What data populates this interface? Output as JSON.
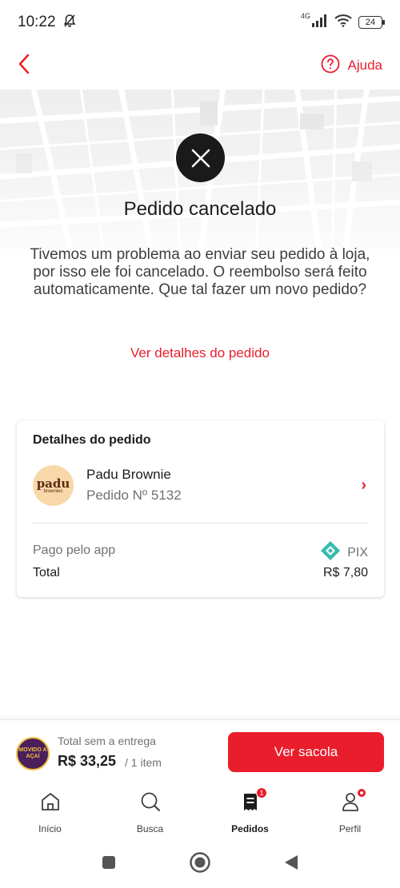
{
  "status_bar": {
    "time": "10:22",
    "network": "4G",
    "battery": "24"
  },
  "top_bar": {
    "help_label": "Ajuda"
  },
  "hero": {
    "title": "Pedido cancelado",
    "message": "Tivemos um problema ao enviar seu pedido à loja, por isso ele foi cancelado. O reembolso será feito automaticamente. Que tal fazer um novo pedido?",
    "details_link": "Ver detalhes do pedido"
  },
  "order_card": {
    "heading": "Detalhes do pedido",
    "store_logo_text": "padu",
    "store_logo_sub": "brownies",
    "store_name": "Padu Brownie",
    "order_number": "Pedido Nº 5132",
    "payment_label": "Pago pelo app",
    "payment_method": "PIX",
    "total_label": "Total",
    "total_value": "R$ 7,80"
  },
  "cart": {
    "avatar_text": "MOVIDO A AÇAÍ",
    "label": "Total sem a entrega",
    "price": "R$ 33,25",
    "count": "/ 1 item",
    "button_label": "Ver sacola"
  },
  "tabs": [
    {
      "label": "Início",
      "icon": "home-icon"
    },
    {
      "label": "Busca",
      "icon": "search-icon"
    },
    {
      "label": "Pedidos",
      "icon": "orders-icon",
      "badge": "1",
      "active": true
    },
    {
      "label": "Perfil",
      "icon": "profile-icon"
    }
  ],
  "colors": {
    "accent": "#ea1d2c",
    "pix": "#32bcad",
    "dark": "#1a1a1a"
  }
}
